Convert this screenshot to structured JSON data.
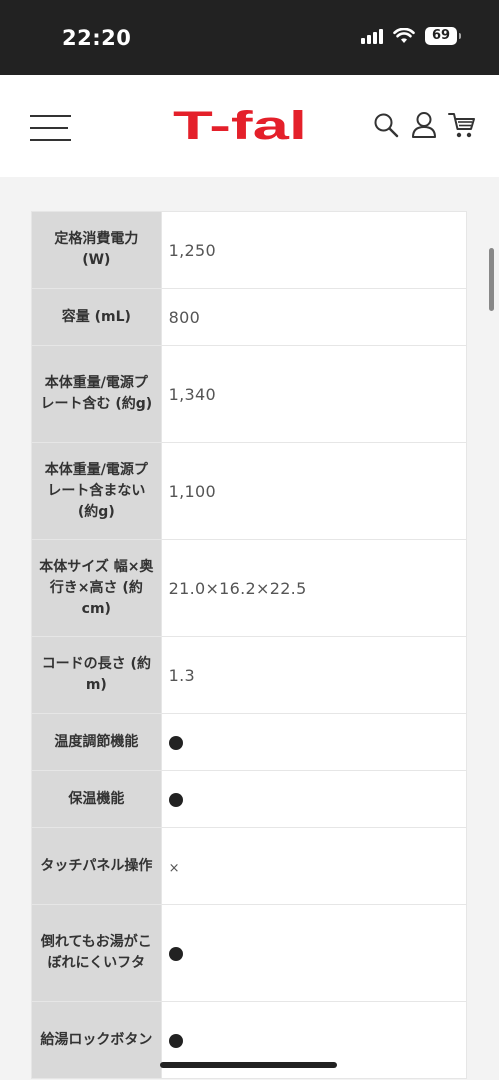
{
  "status_bar": {
    "time": "22:20",
    "battery": "69"
  },
  "header": {
    "brand": "T-fal"
  },
  "colors": {
    "brand_red": "#e4202a",
    "label_bg": "#d9d9d9",
    "status_bg": "#222222"
  },
  "icons": [
    "menu-icon",
    "search-icon",
    "user-icon",
    "cart-icon",
    "signal-icon",
    "wifi-icon",
    "battery-icon"
  ],
  "specs": [
    {
      "label": "定格消費電力 (W)",
      "value": "1,250",
      "type": "text"
    },
    {
      "label": "容量 (mL)",
      "value": "800",
      "type": "text"
    },
    {
      "label": "本体重量/電源プレート含む (約g)",
      "value": "1,340",
      "type": "text"
    },
    {
      "label": "本体重量/電源プレート含まない (約g)",
      "value": "1,100",
      "type": "text"
    },
    {
      "label": "本体サイズ 幅×奥行き×高さ (約cm)",
      "value": "21.0×16.2×22.5",
      "type": "text"
    },
    {
      "label": "コードの長さ (約m)",
      "value": "1.3",
      "type": "text"
    },
    {
      "label": "温度調節機能",
      "value": "●",
      "type": "dot"
    },
    {
      "label": "保温機能",
      "value": "●",
      "type": "dot"
    },
    {
      "label": "タッチパネル操作",
      "value": "×",
      "type": "cross"
    },
    {
      "label": "倒れてもお湯がこぼれにくいフタ",
      "value": "●",
      "type": "dot"
    },
    {
      "label": "給湯ロックボタン",
      "value": "●",
      "type": "dot"
    }
  ]
}
